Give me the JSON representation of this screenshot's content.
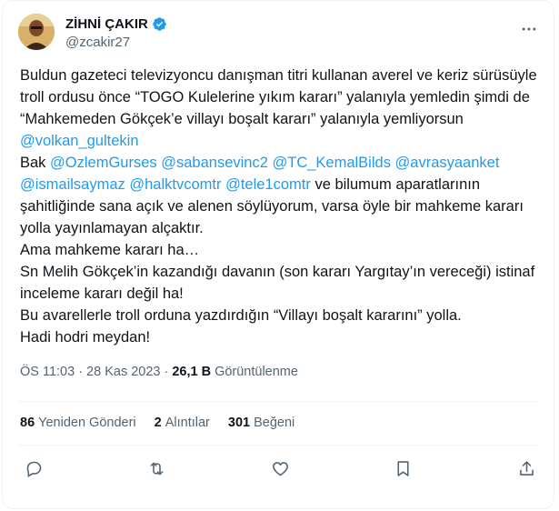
{
  "author": {
    "display_name": "ZİHNİ ÇAKIR",
    "handle": "@zcakir27",
    "verified_icon": "verified-badge-icon"
  },
  "tweet": {
    "line1": "Buldun gazeteci televizyoncu danışman titri kullanan averel ve keriz sürüsüyle troll ordusu önce “TOGO Kulelerine yıkım kararı” yalanıyla yemledin şimdi de “Mahkemeden Gökçek’e villayı boşalt kararı” yalanıyla yemliyorsun ",
    "mention1": "@volkan_gultekin",
    "line2_prefix": "Bak ",
    "mentions2": [
      "@OzlemGurses",
      "@sabansevinc2",
      "@TC_KemalBilds",
      "@avrasyaanket",
      "@ismailsaymaz",
      "@halktvcomtr",
      "@tele1comtr"
    ],
    "line2_suffix": " ve bilumum aparatlarının şahitliğinde sana açık ve alenen söylüyorum, varsa öyle bir mahkeme kararı yolla yayınlamayan alçaktır.",
    "line3": "Ama mahkeme kararı ha…",
    "line4": "Sn Melih Gökçek’in kazandığı davanın (son kararı Yargıtay’ın vereceği) istinaf inceleme kararı değil ha!",
    "line5": "Bu avarellerle troll orduna yazdırdığın “Villayı boşalt kararını” yolla.",
    "line6": "Hadi hodri meydan!"
  },
  "meta": {
    "time": "ÖS 11:03",
    "separator": "·",
    "date": "28 Kas 2023",
    "views_count": "26,1 B",
    "views_label": "Görüntülenme"
  },
  "stats": {
    "retweets_count": "86",
    "retweets_label": "Yeniden Gönderi",
    "quotes_count": "2",
    "quotes_label": "Alıntılar",
    "likes_count": "301",
    "likes_label": "Beğeni"
  },
  "colors": {
    "accent": "#1d9bf0",
    "text": "#0f1419",
    "secondary": "#536471",
    "border": "#eff3f4"
  }
}
